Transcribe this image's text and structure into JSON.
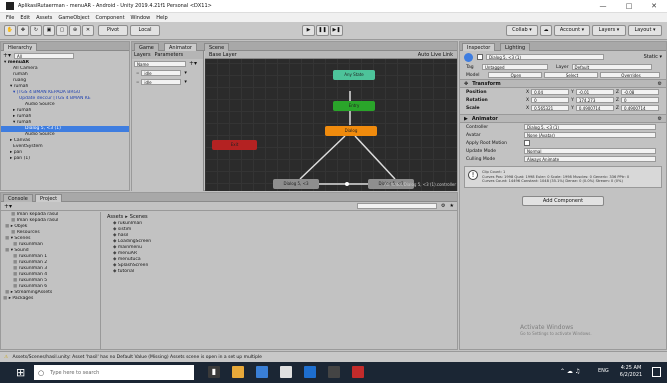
{
  "window": {
    "title": "AplikasiRutaerman - menuAR - Android - Unity 2019.4.21f1 Personal <DX11>"
  },
  "menu": [
    "File",
    "Edit",
    "Assets",
    "GameObject",
    "Component",
    "Window",
    "Help"
  ],
  "toolbar": {
    "pivot": "Pivot",
    "local": "Local",
    "collab": "Collab ▾",
    "account": "Account ▾",
    "layers": "Layers ▾",
    "layout": "Layout ▾"
  },
  "hierarchy": {
    "tab": "Hierarchy",
    "search_placeholder": "All",
    "items": [
      {
        "label": "▾ menuAR",
        "indent": 3,
        "style": "bold"
      },
      {
        "label": "All Camera",
        "indent": 12
      },
      {
        "label": "rumah",
        "indent": 12
      },
      {
        "label": "ruang",
        "indent": 12
      },
      {
        "label": "▾ rumah",
        "indent": 9
      },
      {
        "label": "▾ [TGS 4 BMAN KEPADA BRGU",
        "indent": 12,
        "style": "blue"
      },
      {
        "label": "Update deccur [TGS 4 BMAN KE",
        "indent": 18,
        "style": "blue"
      },
      {
        "label": "Audio Source",
        "indent": 24
      },
      {
        "label": "▸ rumah",
        "indent": 12
      },
      {
        "label": "▸ rumah",
        "indent": 12
      },
      {
        "label": "▾ rumah",
        "indent": 12
      },
      {
        "label": "Dialog 5, <3 (1)",
        "indent": 24,
        "style": "sel"
      },
      {
        "label": "Audio Source",
        "indent": 24
      },
      {
        "label": "▸ Canvas",
        "indent": 9
      },
      {
        "label": "EventSystem",
        "indent": 12
      },
      {
        "label": "▸ pan",
        "indent": 9
      },
      {
        "label": "▸ pan (1)",
        "indent": 9
      }
    ]
  },
  "animator": {
    "tabs": [
      "Game",
      "Animator",
      "Scene"
    ],
    "subtabs": [
      "Layers",
      "Parameters"
    ],
    "base_layer": "Base Layer",
    "auto_live": "Auto Live Link",
    "params_search": "Name",
    "params": [
      "idle",
      "idle"
    ],
    "states": [
      {
        "label": "Any State",
        "color": "#4dc39a"
      },
      {
        "label": "Entry",
        "color": "#2aa52a"
      },
      {
        "label": "Dialog",
        "color": "#f08b0d"
      },
      {
        "label": "Exit",
        "color": "#b42222"
      },
      {
        "label": "Dialog 5, <3",
        "color": "#8e8e8e"
      },
      {
        "label": "Dialog 5, <3",
        "color": "#8e8e8e"
      }
    ],
    "footer_path": "Animator/Dialog 5, <3 (1).controller"
  },
  "project": {
    "tabs": [
      "Console",
      "Project"
    ],
    "breadcrumb": [
      "Assets",
      "Scenes"
    ],
    "sidebar": [
      {
        "label": "Iman kepada rasul",
        "indent": 10
      },
      {
        "label": "Iman kepada rasul",
        "indent": 10
      },
      {
        "label": "▸ Objek",
        "indent": 4
      },
      {
        "label": "Resources",
        "indent": 10
      },
      {
        "label": "▾ Scenes",
        "indent": 4
      },
      {
        "label": "rukunIman",
        "indent": 12
      },
      {
        "label": "▾ Sound",
        "indent": 4
      },
      {
        "label": "rukunIman 1",
        "indent": 12
      },
      {
        "label": "rukunIman 2",
        "indent": 12
      },
      {
        "label": "rukunIman 3",
        "indent": 12
      },
      {
        "label": "rukunIman 4",
        "indent": 12
      },
      {
        "label": "rukunIman 5",
        "indent": 12
      },
      {
        "label": "rukunIman 6",
        "indent": 12
      },
      {
        "label": "▸ StreamingAssets",
        "indent": 4
      },
      {
        "label": "▸ Packages",
        "indent": 2
      }
    ],
    "files": [
      "rukunIman",
      "sistim",
      "hasil",
      "LoadingScreen",
      "mainmenu",
      "menuAR",
      "menutuca",
      "SplashScreen",
      "tutorial"
    ]
  },
  "inspector": {
    "tabs": [
      "Inspector",
      "Lighting"
    ],
    "object_name": "Dialog 5, <3 (1)",
    "static": "Static ▾",
    "tag_label": "Tag",
    "tag": "Untagged",
    "layer_label": "Layer",
    "layer": "Default",
    "model_label": "Model",
    "model_buttons": [
      "Open",
      "Select",
      "Overrides"
    ],
    "transform": {
      "title": "Transform",
      "rows": [
        {
          "label": "Position",
          "x": "0.04",
          "y": "-0.01",
          "z": "-0.08"
        },
        {
          "label": "Rotation",
          "x": "0",
          "y": "174.273",
          "z": "0"
        },
        {
          "label": "Scale",
          "x": "0.565321",
          "y": "0.4900714",
          "z": "0.4900714"
        }
      ]
    },
    "animator": {
      "title": "Animator",
      "rows": [
        {
          "label": "Controller",
          "value": "Dialog 5, <3 (1)"
        },
        {
          "label": "Avatar",
          "value": "None (Avatar)"
        },
        {
          "label": "Apply Root Motion",
          "value": ""
        },
        {
          "label": "Update Mode",
          "value": "Normal"
        },
        {
          "label": "Culling Mode",
          "value": "Always Animate"
        }
      ],
      "info": "Clip Count: 1\nCurves Pos: 1998 Quat: 1998 Euler: 0 Scale: 1998 Muscles: 0 Generic: 336 PPtr: 0\nCurves Count: 14496 Constant: 1048 (35.1%) Dense: 0 (0.0%) Stream: 0 (0%)"
    },
    "add_component": "Add Component"
  },
  "status": {
    "message": "Assets/Scenes/hasil.unity: Asset 'hasil' has no Default Value (Missing) Assets scene is open in a set up multiple"
  },
  "watermark": {
    "line1": "Activate Windows",
    "line2": "Go to Settings to activate Windows."
  },
  "taskbar": {
    "search_placeholder": "Type here to search",
    "time": "4:25 AM",
    "date": "6/2/2021",
    "lang": "ENG"
  }
}
